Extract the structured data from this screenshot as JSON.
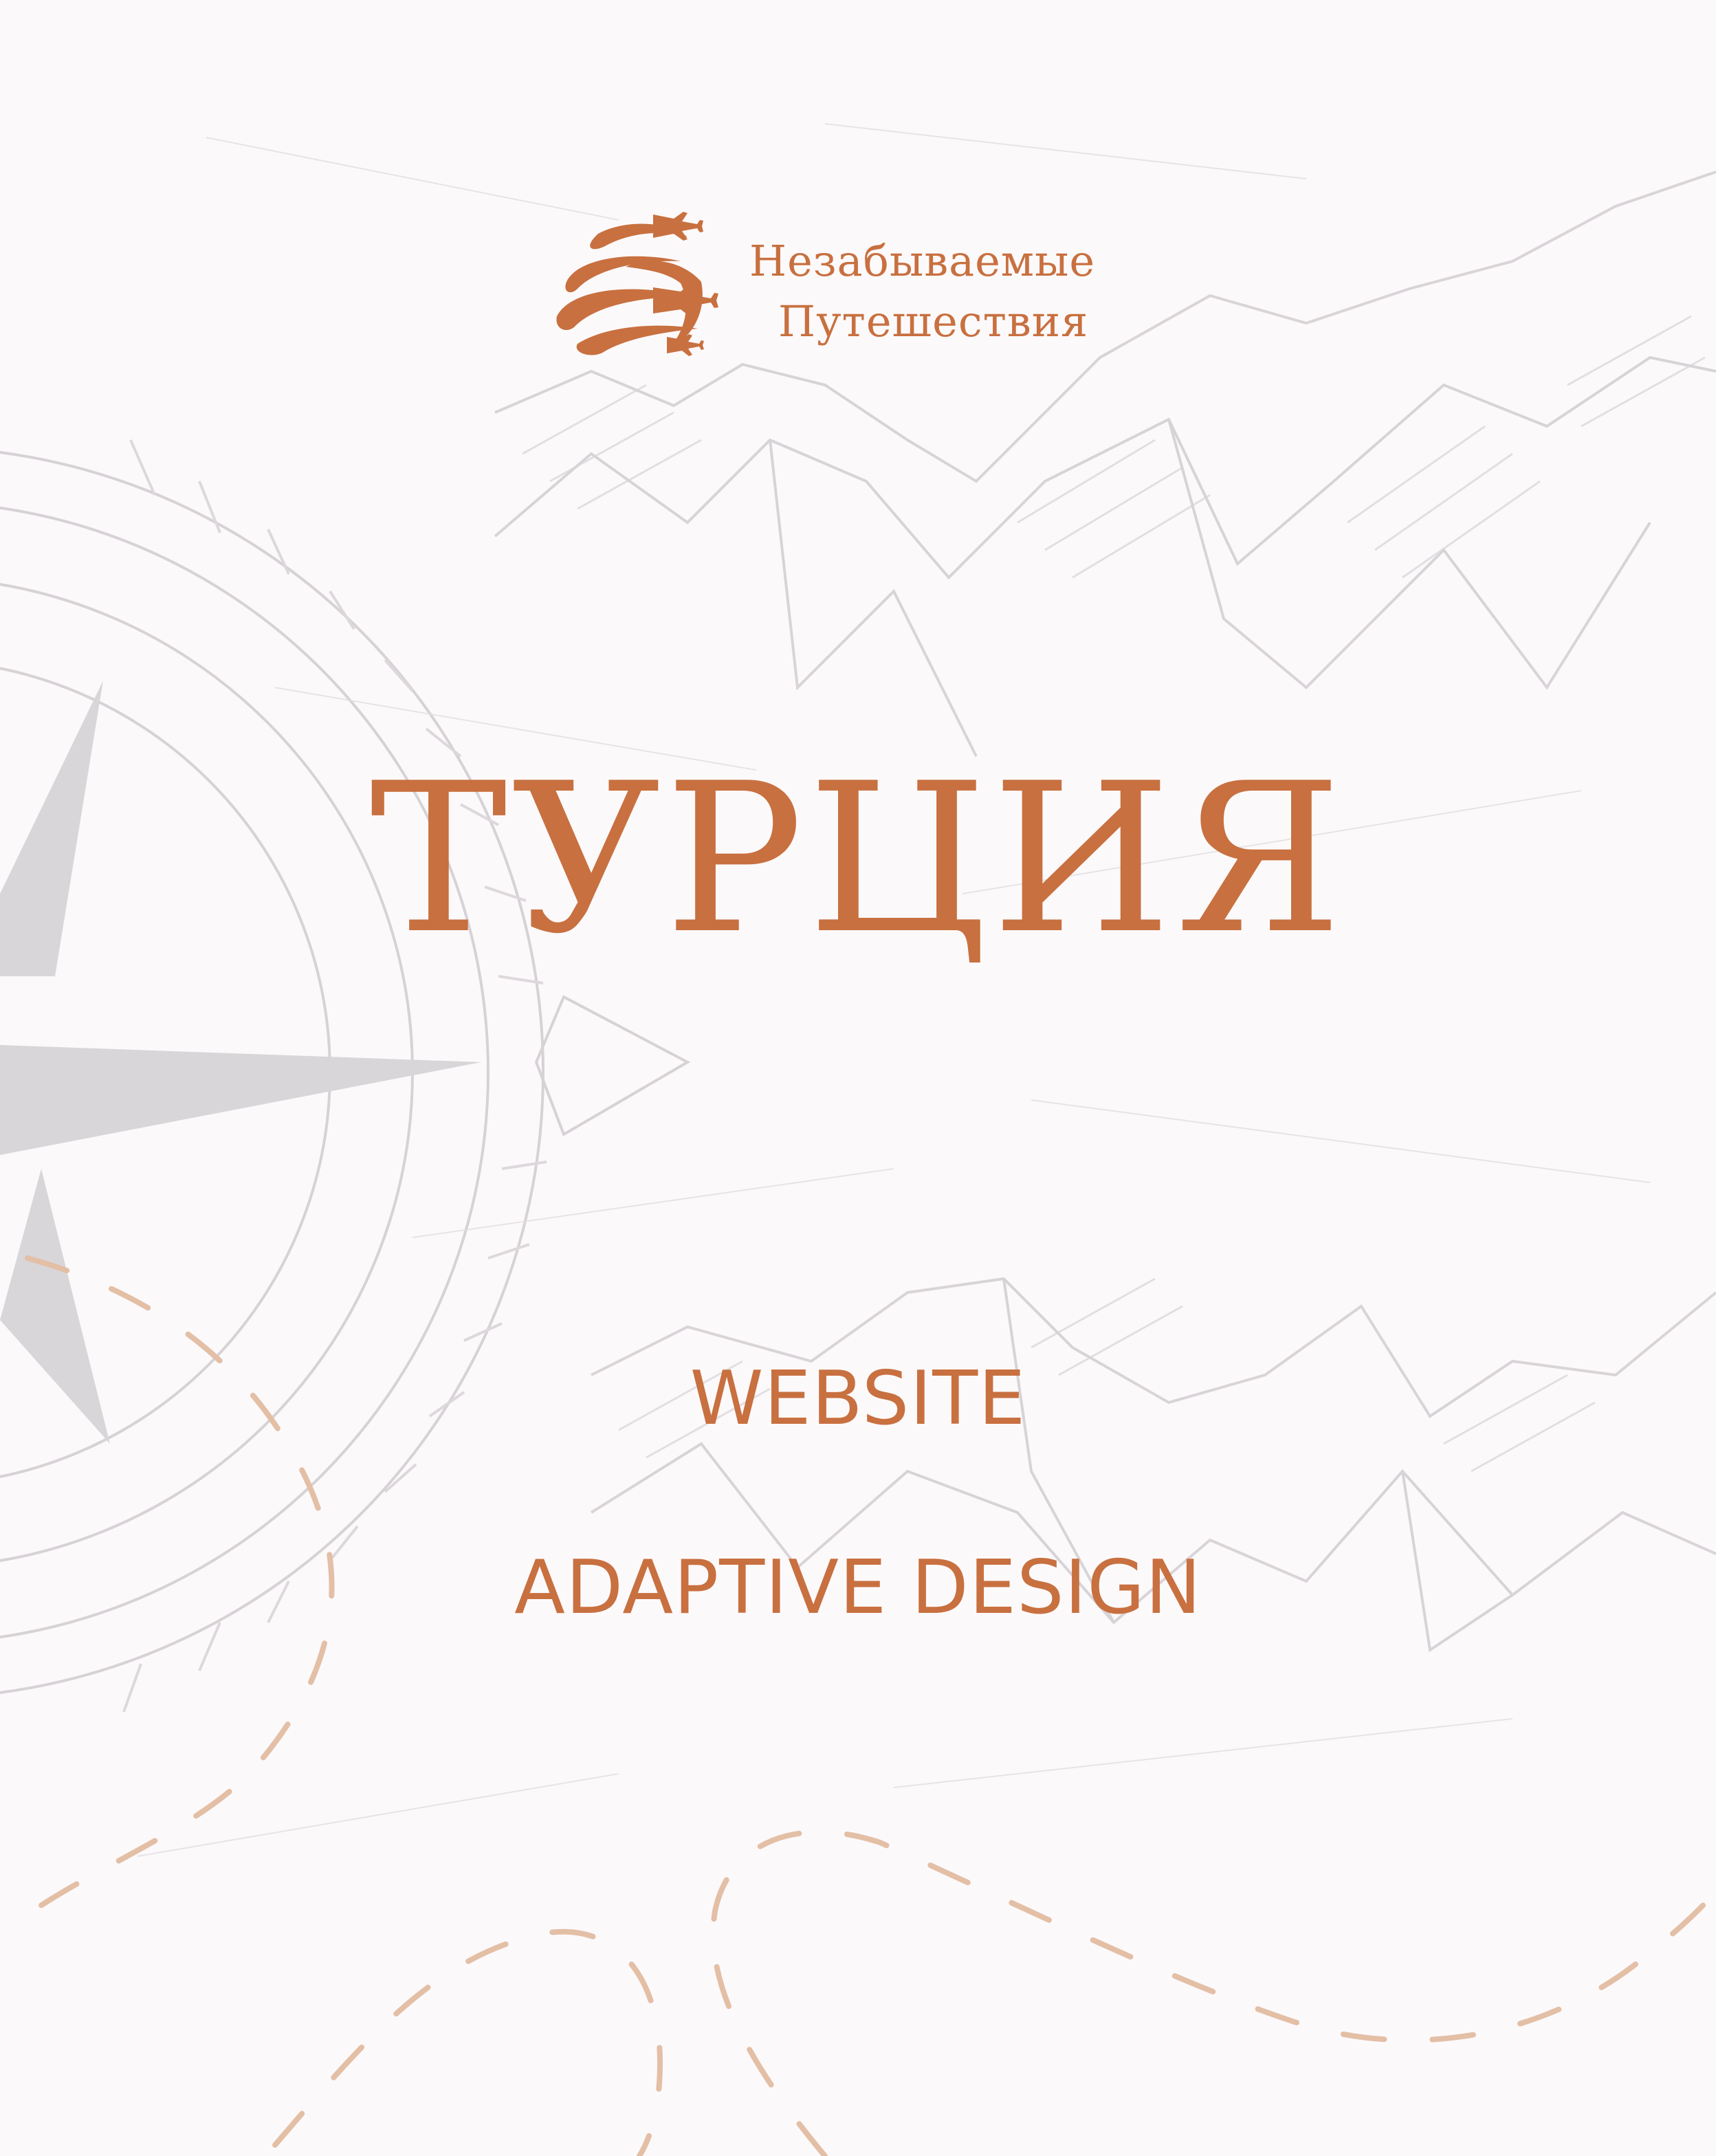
{
  "logo": {
    "line1": "Незабываемые",
    "line2": "Путешествия",
    "icon": "globe-with-airplanes-icon"
  },
  "title": "ТУРЦИЯ",
  "subtitles": {
    "website": "WEBSITE",
    "adaptive": "ADAPTIVE DESIGN"
  },
  "colors": {
    "accent": "#c8703f",
    "background": "#fcf9fb",
    "sketch": "#cfcbcf",
    "dashes": "#e3bfa6"
  },
  "decor": {
    "background_art": "compass-and-mountains-sketch",
    "route": "dashed-route-lines"
  }
}
